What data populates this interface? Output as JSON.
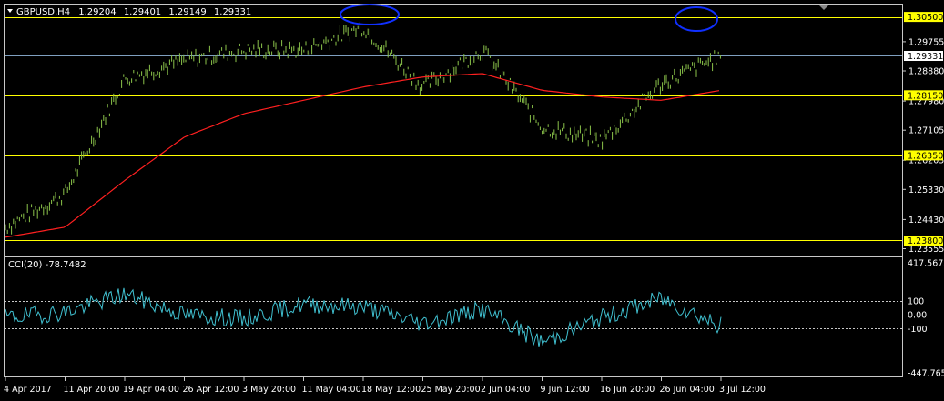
{
  "header": {
    "symbol": "GBPUSD,H4",
    "open": "1.29204",
    "high": "1.29401",
    "low": "1.29149",
    "close": "1.29331"
  },
  "cci_header": "CCI(20) -78.7482",
  "colors": {
    "background": "#000000",
    "grid_frame": "#c8c8c8",
    "price_bars": "#8bc34a",
    "moving_average": "#ff2020",
    "horizontal_levels": "#ffff00",
    "highlight_label_bg": "#ffff00",
    "current_price_line": "#7f9fbf",
    "cci_line": "#40c0d0",
    "ellipse": "#1030ff"
  },
  "price_axis": {
    "ticks": [
      "1.29755",
      "1.28880",
      "1.27980",
      "1.27105",
      "1.26205",
      "1.25330",
      "1.24430",
      "1.23555"
    ],
    "current_price": "1.29331",
    "levels": [
      "1.30500",
      "1.28150",
      "1.26350",
      "1.23800"
    ]
  },
  "cci_axis": {
    "ticks": [
      "417.5672",
      "100",
      "0.00",
      "-100",
      "-447.7658"
    ]
  },
  "time_axis": {
    "labels": [
      "4 Apr 2017",
      "11 Apr 20:00",
      "19 Apr 04:00",
      "26 Apr 12:00",
      "3 May 20:00",
      "11 May 04:00",
      "18 May 12:00",
      "25 May 20:00",
      "2 Jun 04:00",
      "9 Jun 12:00",
      "16 Jun 20:00",
      "26 Jun 04:00",
      "3 Jul 12:00"
    ]
  },
  "chart_data": {
    "type": "line",
    "title": "GBPUSD,H4",
    "x": [
      "4 Apr 2017",
      "11 Apr 20:00",
      "19 Apr 04:00",
      "26 Apr 12:00",
      "3 May 20:00",
      "11 May 04:00",
      "18 May 12:00",
      "25 May 20:00",
      "2 Jun 04:00",
      "9 Jun 12:00",
      "16 Jun 20:00",
      "26 Jun 04:00",
      "3 Jul 12:00"
    ],
    "series": [
      {
        "values": [
          1.242,
          1.252,
          1.2865,
          1.292,
          1.295,
          1.295,
          1.302,
          1.284,
          1.295,
          1.272,
          1.268,
          1.285,
          1.2933
        ]
      },
      {
        "values": [
          1.239,
          1.242,
          1.256,
          1.269,
          1.276,
          1.28,
          1.284,
          1.287,
          1.288,
          1.283,
          1.281,
          1.28,
          1.283
        ]
      },
      {
        "values": [
          -20,
          20,
          150,
          0,
          -30,
          80,
          60,
          -60,
          40,
          -200,
          -20,
          120,
          -79
        ]
      }
    ],
    "ylim": [
      1.2335,
      1.3087
    ],
    "levels": [
      1.305,
      1.2815,
      1.2635,
      1.238
    ],
    "cci_ylim": [
      -447.7658,
      417.5672
    ],
    "cci_levels": [
      100,
      -100
    ]
  }
}
